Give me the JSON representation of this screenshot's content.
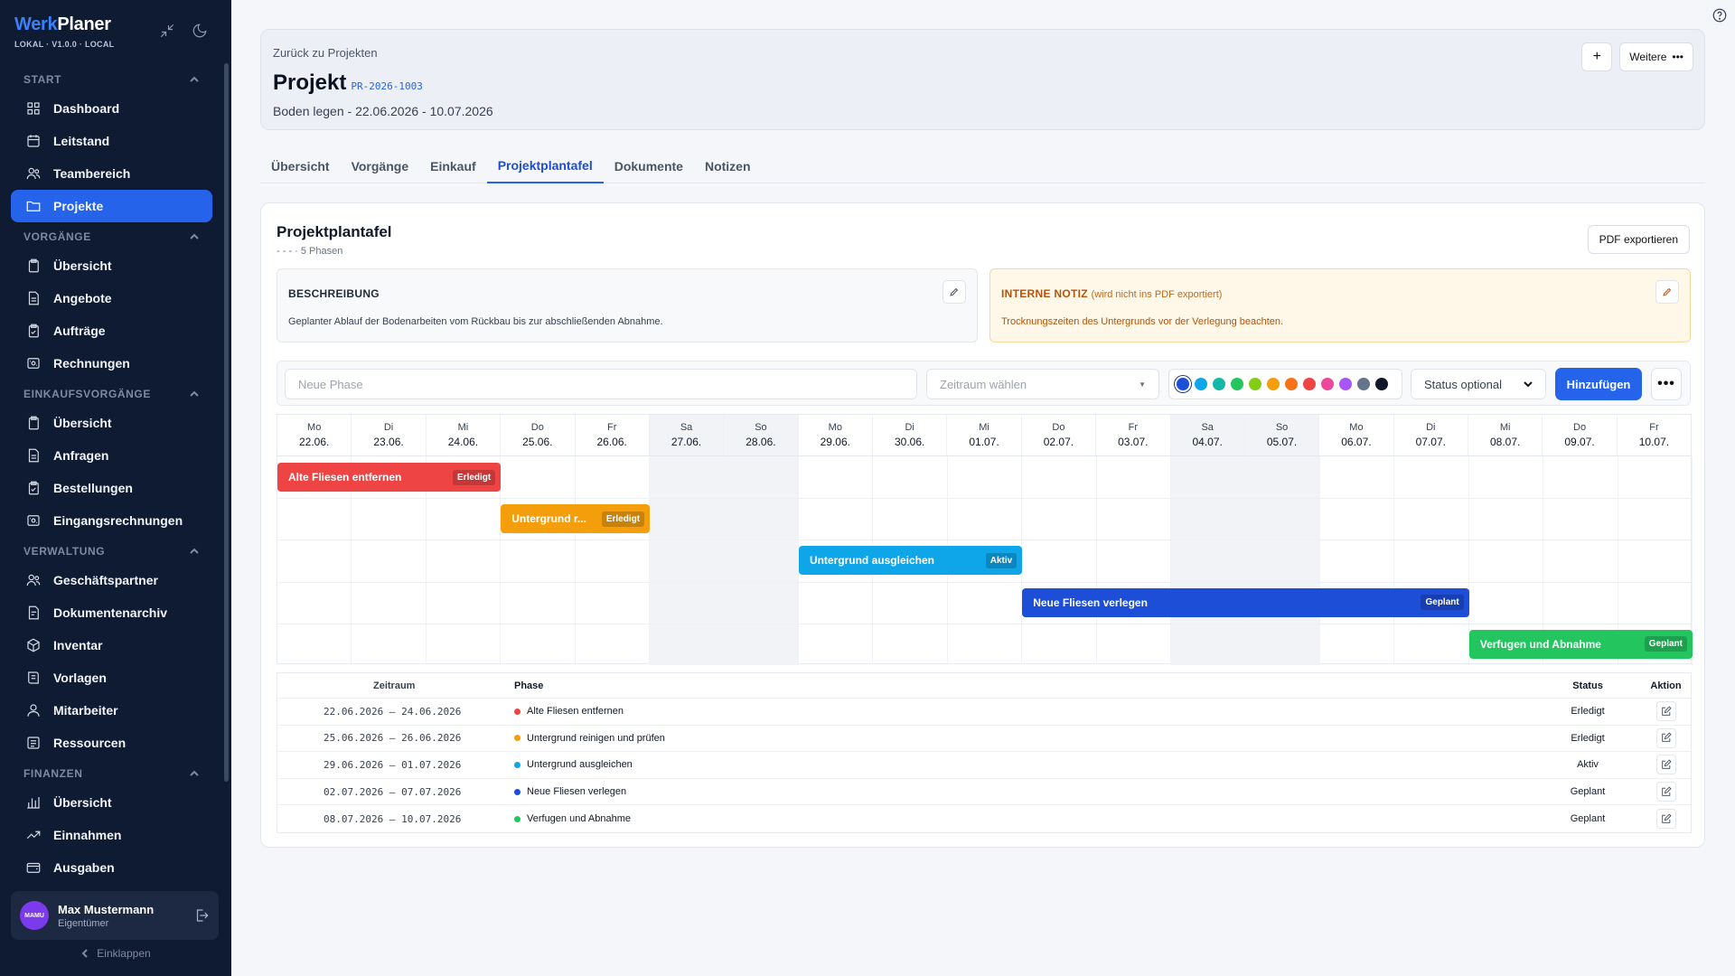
{
  "app": {
    "brand_part1": "Werk",
    "brand_part2": "Planer",
    "version": "LOKAL · V1.0.0 · LOCAL"
  },
  "sidebar": {
    "sections": [
      {
        "label": "START",
        "items": [
          {
            "label": "Dashboard",
            "icon": "grid-icon",
            "active": false
          },
          {
            "label": "Leitstand",
            "icon": "calendar-icon",
            "active": false
          },
          {
            "label": "Teambereich",
            "icon": "users-icon",
            "active": false
          },
          {
            "label": "Projekte",
            "icon": "folder-icon",
            "active": true
          }
        ]
      },
      {
        "label": "VORGÄNGE",
        "items": [
          {
            "label": "Übersicht",
            "icon": "clipboard-icon",
            "active": false
          },
          {
            "label": "Angebote",
            "icon": "document-icon",
            "active": false
          },
          {
            "label": "Aufträge",
            "icon": "clipboard-check-icon",
            "active": false
          },
          {
            "label": "Rechnungen",
            "icon": "receipt-icon",
            "active": false
          }
        ]
      },
      {
        "label": "EINKAUFSVORGÄNGE",
        "items": [
          {
            "label": "Übersicht",
            "icon": "clipboard-icon",
            "active": false
          },
          {
            "label": "Anfragen",
            "icon": "document-icon",
            "active": false
          },
          {
            "label": "Bestellungen",
            "icon": "clipboard-check-icon",
            "active": false
          },
          {
            "label": "Eingangsrechnungen",
            "icon": "receipt-icon",
            "active": false
          }
        ]
      },
      {
        "label": "VERWALTUNG",
        "items": [
          {
            "label": "Geschäftspartner",
            "icon": "users-icon",
            "active": false
          },
          {
            "label": "Dokumentenarchiv",
            "icon": "archive-icon",
            "active": false
          },
          {
            "label": "Inventar",
            "icon": "box-icon",
            "active": false
          },
          {
            "label": "Vorlagen",
            "icon": "template-icon",
            "active": false
          },
          {
            "label": "Mitarbeiter",
            "icon": "user-icon",
            "active": false
          },
          {
            "label": "Ressourcen",
            "icon": "list-icon",
            "active": false
          }
        ]
      },
      {
        "label": "FINANZEN",
        "items": [
          {
            "label": "Übersicht",
            "icon": "bar-chart-icon",
            "active": false
          },
          {
            "label": "Einnahmen",
            "icon": "trend-up-icon",
            "active": false
          },
          {
            "label": "Ausgaben",
            "icon": "wallet-icon",
            "active": false
          }
        ]
      }
    ],
    "user": {
      "initials": "MAMU",
      "name": "Max Mustermann",
      "role": "Eigentümer"
    },
    "collapse_label": "Einklappen"
  },
  "header": {
    "back_label": "Zurück zu Projekten",
    "title": "Projekt",
    "code": "PR-2026-1003",
    "subtitle": "Boden legen - 22.06.2026 - 10.07.2026",
    "add_label": "+",
    "more_label": "Weitere"
  },
  "tabs": [
    {
      "label": "Übersicht",
      "active": false
    },
    {
      "label": "Vorgänge",
      "active": false
    },
    {
      "label": "Einkauf",
      "active": false
    },
    {
      "label": "Projektplantafel",
      "active": true
    },
    {
      "label": "Dokumente",
      "active": false
    },
    {
      "label": "Notizen",
      "active": false
    }
  ],
  "board": {
    "title": "Projektplantafel",
    "subtitle": "- - - · 5 Phasen",
    "pdf_label": "PDF exportieren",
    "description": {
      "label": "BESCHREIBUNG",
      "text": "Geplanter Ablauf der Bodenarbeiten vom Rückbau bis zur abschließenden Abnahme."
    },
    "note": {
      "label": "INTERNE NOTIZ",
      "hint": "(wird nicht ins PDF exportiert)",
      "text": "Trocknungszeiten des Untergrunds vor der Verlegung beachten."
    },
    "form": {
      "phase_placeholder": "Neue Phase",
      "range_placeholder": "Zeitraum wählen",
      "status_placeholder": "Status optional",
      "add_label": "Hinzufügen",
      "colors": [
        "#1d4ed8",
        "#0ea5e9",
        "#14b8a6",
        "#22c55e",
        "#84cc16",
        "#f59e0b",
        "#f97316",
        "#ef4444",
        "#ec4899",
        "#a855f7",
        "#64748b",
        "#111827"
      ],
      "selected_color": 0
    },
    "days": [
      {
        "dn": "Mo",
        "dd": "22.06.",
        "weekend": false
      },
      {
        "dn": "Di",
        "dd": "23.06.",
        "weekend": false
      },
      {
        "dn": "Mi",
        "dd": "24.06.",
        "weekend": false
      },
      {
        "dn": "Do",
        "dd": "25.06.",
        "weekend": false
      },
      {
        "dn": "Fr",
        "dd": "26.06.",
        "weekend": false
      },
      {
        "dn": "Sa",
        "dd": "27.06.",
        "weekend": true
      },
      {
        "dn": "So",
        "dd": "28.06.",
        "weekend": true
      },
      {
        "dn": "Mo",
        "dd": "29.06.",
        "weekend": false
      },
      {
        "dn": "Di",
        "dd": "30.06.",
        "weekend": false
      },
      {
        "dn": "Mi",
        "dd": "01.07.",
        "weekend": false
      },
      {
        "dn": "Do",
        "dd": "02.07.",
        "weekend": false
      },
      {
        "dn": "Fr",
        "dd": "03.07.",
        "weekend": false
      },
      {
        "dn": "Sa",
        "dd": "04.07.",
        "weekend": true
      },
      {
        "dn": "So",
        "dd": "05.07.",
        "weekend": true
      },
      {
        "dn": "Mo",
        "dd": "06.07.",
        "weekend": false
      },
      {
        "dn": "Di",
        "dd": "07.07.",
        "weekend": false
      },
      {
        "dn": "Mi",
        "dd": "08.07.",
        "weekend": false
      },
      {
        "dn": "Do",
        "dd": "09.07.",
        "weekend": false
      },
      {
        "dn": "Fr",
        "dd": "10.07.",
        "weekend": false
      }
    ],
    "phases": [
      {
        "name": "Alte Fliesen entfernen",
        "bar_label": "Alte Fliesen entfernen",
        "start": 0,
        "end": 2,
        "status": "Erledigt",
        "color": "#ef4444",
        "range": "22.06.2026 – 24.06.2026"
      },
      {
        "name": "Untergrund reinigen und prüfen",
        "bar_label": "Untergrund r...",
        "start": 3,
        "end": 4,
        "status": "Erledigt",
        "color": "#f59e0b",
        "range": "25.06.2026 – 26.06.2026"
      },
      {
        "name": "Untergrund ausgleichen",
        "bar_label": "Untergrund ausgleichen",
        "start": 7,
        "end": 9,
        "status": "Aktiv",
        "color": "#0ea5e9",
        "range": "29.06.2026 – 01.07.2026"
      },
      {
        "name": "Neue Fliesen verlegen",
        "bar_label": "Neue Fliesen verlegen",
        "start": 10,
        "end": 15,
        "status": "Geplant",
        "color": "#1d4ed8",
        "range": "02.07.2026 – 07.07.2026"
      },
      {
        "name": "Verfugen und Abnahme",
        "bar_label": "Verfugen und Abnahme",
        "start": 16,
        "end": 18,
        "status": "Geplant",
        "color": "#22c55e",
        "range": "08.07.2026 – 10.07.2026"
      }
    ],
    "table_headers": {
      "range": "Zeitraum",
      "phase": "Phase",
      "status": "Status",
      "action": "Aktion"
    }
  }
}
